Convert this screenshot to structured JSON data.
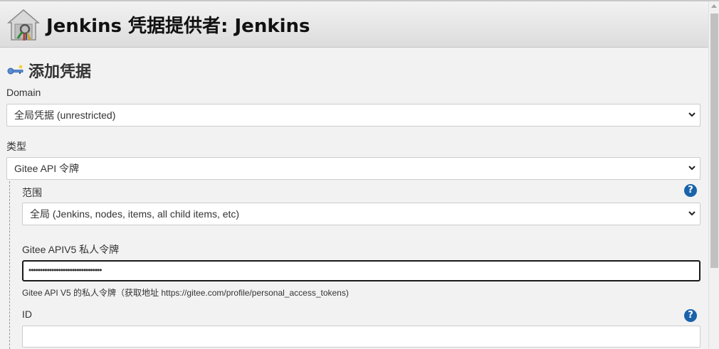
{
  "header": {
    "title": "Jenkins 凭据提供者: Jenkins",
    "icon": "credentials-store-icon"
  },
  "section": {
    "title": "添加凭据",
    "icon": "key-icon"
  },
  "domain": {
    "label": "Domain",
    "selected": "全局凭据 (unrestricted)"
  },
  "kind": {
    "label": "类型",
    "selected": "Gitee API 令牌"
  },
  "scope": {
    "label": "范围",
    "selected": "全局 (Jenkins, nodes, items, all child items, etc)",
    "help": "?"
  },
  "token": {
    "label": "Gitee APIV5 私人令牌",
    "masked_value": "••••••••••••••••••••••••••••••••",
    "hint": "Gitee API V5 的私人令牌（获取地址 https://gitee.com/profile/personal_access_tokens)"
  },
  "id_field": {
    "label": "ID",
    "value": "",
    "help": "?"
  },
  "colors": {
    "help_blue": "#1a63ab",
    "page_bg": "#f2f2f2"
  }
}
